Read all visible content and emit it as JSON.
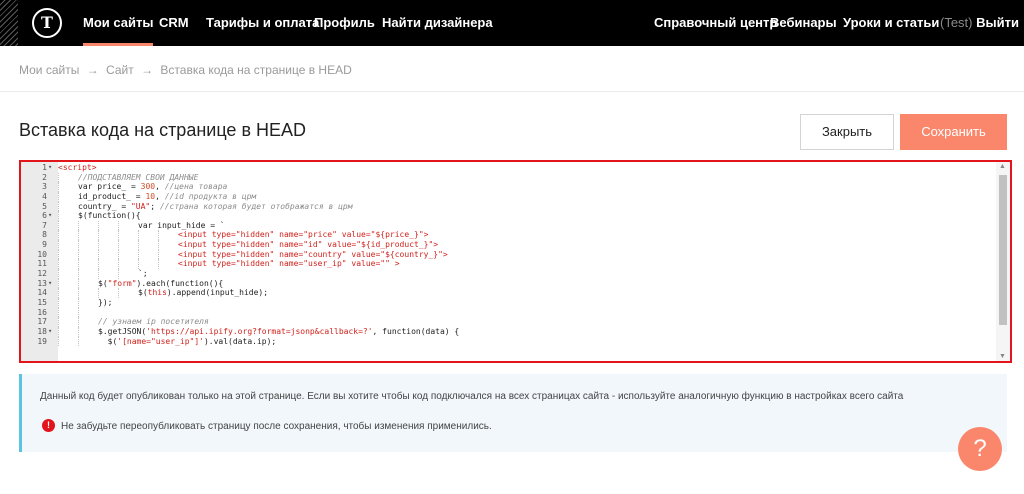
{
  "header": {
    "logo_letter": "T",
    "nav": [
      "Мои сайты",
      "CRM",
      "Тарифы и оплата",
      "Профиль",
      "Найти дизайнера"
    ],
    "right": [
      "Справочный центр",
      "Вебинары",
      "Уроки и статьи"
    ],
    "test_label": "(Test)",
    "logout": "Выйти",
    "accent_color": "#fa876b"
  },
  "breadcrumb": {
    "items": [
      "Мои сайты",
      "Сайт",
      "Вставка кода на странице в HEAD"
    ],
    "separator": "→"
  },
  "page": {
    "title": "Вставка кода на странице в HEAD",
    "close_label": "Закрыть",
    "save_label": "Сохранить"
  },
  "editor": {
    "lines": [
      {
        "n": "1",
        "fold": true,
        "i": 0,
        "code": [
          [
            "t-tag",
            "<script>"
          ]
        ]
      },
      {
        "n": "2",
        "fold": false,
        "i": 1,
        "code": [
          [
            "t-com",
            "//ПОДСТАВЛЯЕМ СВОИ ДАННЫЕ"
          ]
        ]
      },
      {
        "n": "3",
        "fold": false,
        "i": 1,
        "code": [
          [
            "t-kw",
            "var price_ = "
          ],
          [
            "t-num",
            "300"
          ],
          [
            "t-kw",
            ", "
          ],
          [
            "t-com",
            "//цена товара"
          ]
        ]
      },
      {
        "n": "4",
        "fold": false,
        "i": 1,
        "code": [
          [
            "t-kw",
            "id_product_ = "
          ],
          [
            "t-num",
            "10"
          ],
          [
            "t-kw",
            ", "
          ],
          [
            "t-com",
            "//id продукта в црм"
          ]
        ]
      },
      {
        "n": "5",
        "fold": false,
        "i": 1,
        "code": [
          [
            "t-kw",
            "country_ = "
          ],
          [
            "t-str",
            "\"UA\""
          ],
          [
            "t-kw",
            "; "
          ],
          [
            "t-com",
            "//страна которая будет отображатся в црм"
          ]
        ]
      },
      {
        "n": "6",
        "fold": true,
        "i": 1,
        "code": [
          [
            "t-kw",
            "$(function(){"
          ]
        ]
      },
      {
        "n": "7",
        "fold": false,
        "i": 4,
        "code": [
          [
            "t-kw",
            "var input_hide = `"
          ]
        ]
      },
      {
        "n": "8",
        "fold": false,
        "i": 6,
        "code": [
          [
            "t-tag",
            "<input type=\"hidden\" name=\"price\" value=\"${price_}\">"
          ]
        ]
      },
      {
        "n": "9",
        "fold": false,
        "i": 6,
        "code": [
          [
            "t-tag",
            "<input type=\"hidden\" name=\"id\" value=\"${id_product_}\">"
          ]
        ]
      },
      {
        "n": "10",
        "fold": false,
        "i": 6,
        "code": [
          [
            "t-tag",
            "<input type=\"hidden\" name=\"country\" value=\"${country_}\">"
          ]
        ]
      },
      {
        "n": "11",
        "fold": false,
        "i": 6,
        "code": [
          [
            "t-tag",
            "<input type=\"hidden\" name=\"user_ip\" value=\"\" >"
          ]
        ]
      },
      {
        "n": "12",
        "fold": false,
        "i": 4,
        "code": [
          [
            "t-kw",
            "`;"
          ]
        ]
      },
      {
        "n": "13",
        "fold": true,
        "i": 2,
        "code": [
          [
            "t-kw",
            "$("
          ],
          [
            "t-str",
            "\"form\""
          ],
          [
            "t-kw",
            ").each(function(){"
          ]
        ]
      },
      {
        "n": "14",
        "fold": false,
        "i": 4,
        "code": [
          [
            "t-kw",
            "$("
          ],
          [
            "t-str",
            "this"
          ],
          [
            "t-kw",
            ").append(input_hide);"
          ]
        ]
      },
      {
        "n": "15",
        "fold": false,
        "i": 2,
        "code": [
          [
            "t-kw",
            "});"
          ]
        ]
      },
      {
        "n": "16",
        "fold": false,
        "i": 2,
        "code": []
      },
      {
        "n": "17",
        "fold": false,
        "i": 2,
        "code": [
          [
            "t-com",
            "// узнаем ip посетителя"
          ]
        ]
      },
      {
        "n": "18",
        "fold": true,
        "i": 2,
        "code": [
          [
            "t-kw",
            "$.getJSON("
          ],
          [
            "t-str",
            "'https://api.ipify.org?format=jsonp&callback=?'"
          ],
          [
            "t-kw",
            ", function(data) {"
          ]
        ]
      },
      {
        "n": "19",
        "fold": false,
        "i": 2,
        "code": [
          [
            "t-kw",
            "  $("
          ],
          [
            "t-str",
            "'[name=\"user_ip\"]'"
          ],
          [
            "t-kw",
            ").val(data.ip);"
          ]
        ]
      }
    ]
  },
  "info": {
    "text": "Данный код будет опубликован только на этой странице. Если вы хотите чтобы код подключался на всех страницах сайта - используйте аналогичную функцию в настройках всего сайта",
    "warning": "Не забудьте переопубликовать страницу после сохранения, чтобы изменения применились.",
    "warning_icon": "!",
    "accent_color": "#5cc3e0"
  },
  "help": {
    "label": "?"
  }
}
